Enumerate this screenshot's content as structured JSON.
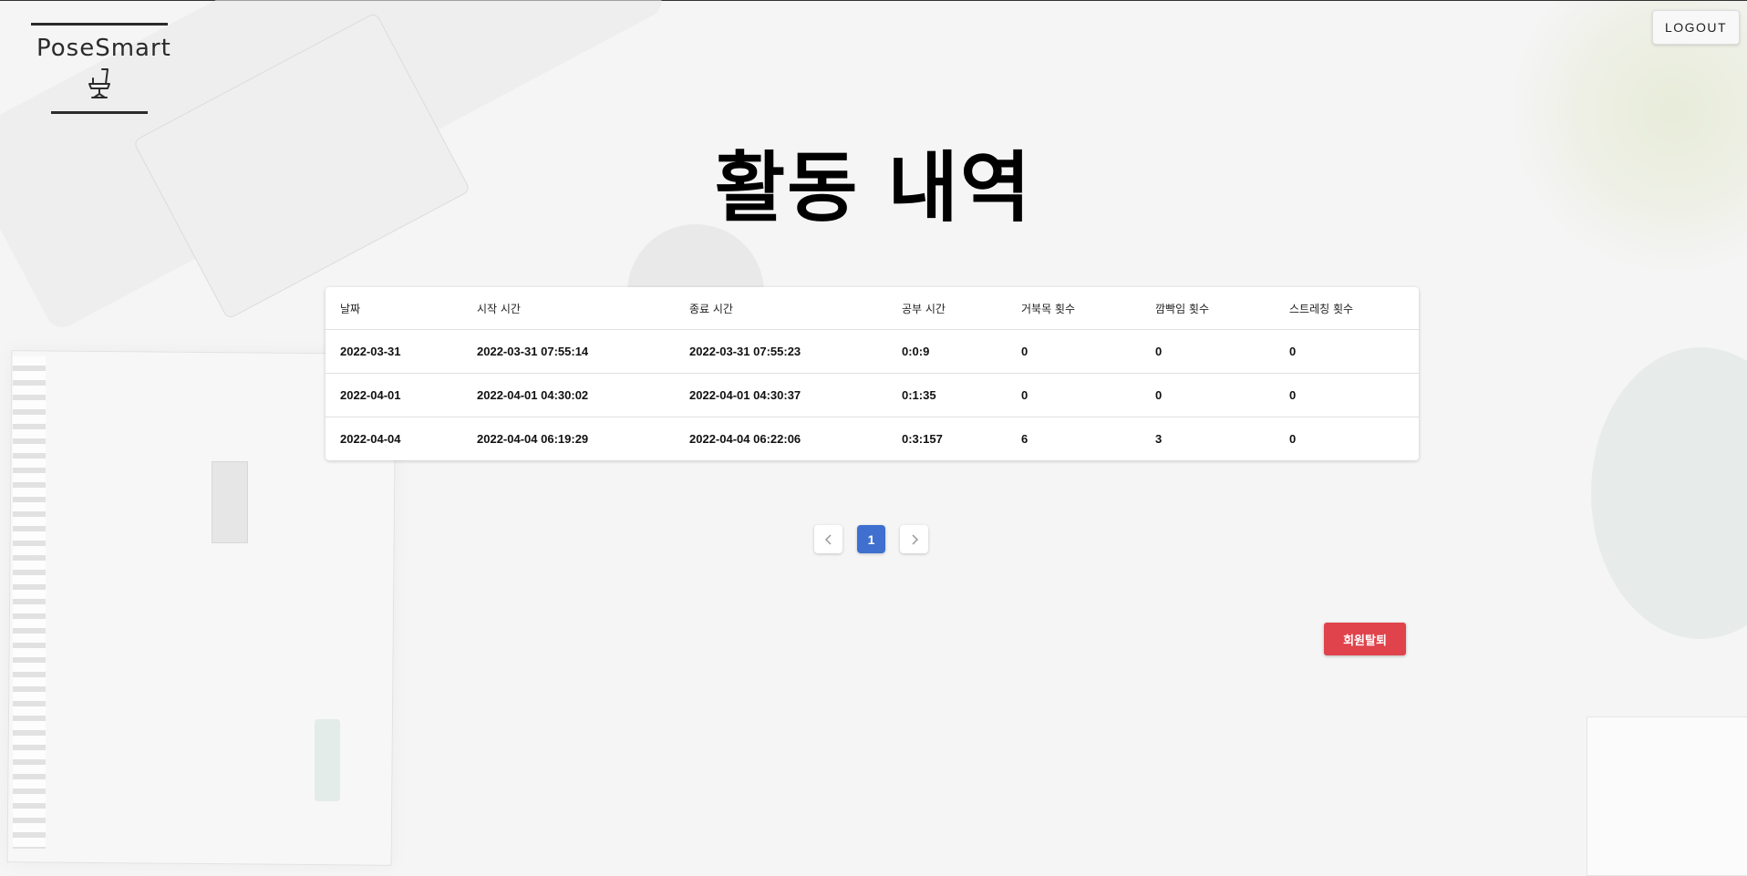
{
  "logo": {
    "brand": "PoseSmart"
  },
  "header": {
    "logout_label": "LOGOUT"
  },
  "page": {
    "title": "활동 내역"
  },
  "table": {
    "columns": [
      "날짜",
      "시작 시간",
      "종료 시간",
      "공부 시간",
      "거북목 횟수",
      "깜빡임 횟수",
      "스트레칭 횟수"
    ],
    "rows": [
      [
        "2022-03-31",
        "2022-03-31 07:55:14",
        "2022-03-31 07:55:23",
        "0:0:9",
        "0",
        "0",
        "0"
      ],
      [
        "2022-04-01",
        "2022-04-01 04:30:02",
        "2022-04-01 04:30:37",
        "0:1:35",
        "0",
        "0",
        "0"
      ],
      [
        "2022-04-04",
        "2022-04-04 06:19:29",
        "2022-04-04 06:22:06",
        "0:3:157",
        "6",
        "3",
        "0"
      ]
    ]
  },
  "pagination": {
    "current_page": "1",
    "prev_icon": "chevron-left-icon",
    "next_icon": "chevron-right-icon"
  },
  "actions": {
    "withdraw_label": "회원탈퇴"
  },
  "colors": {
    "accent": "#3f6fcf",
    "danger": "#e0434b"
  }
}
